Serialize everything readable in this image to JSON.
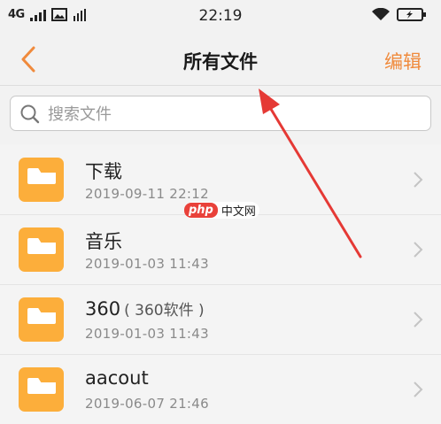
{
  "status_bar": {
    "network": "4G",
    "time": "22:19"
  },
  "nav": {
    "title": "所有文件",
    "edit_label": "编辑"
  },
  "search": {
    "placeholder": "搜索文件"
  },
  "files": [
    {
      "name": "下载",
      "sub": "",
      "date": "2019-09-11 22:12"
    },
    {
      "name": "音乐",
      "sub": "",
      "date": "2019-01-03 11:43"
    },
    {
      "name": "360",
      "sub": "( 360软件 )",
      "date": "2019-01-03 11:43"
    },
    {
      "name": "aacout",
      "sub": "",
      "date": "2019-06-07 21:46"
    }
  ],
  "watermark": {
    "logo": "php",
    "text": "中文网"
  },
  "colors": {
    "accent": "#f08a3c",
    "folder": "#fcae3b",
    "annotation_arrow": "#e53935"
  }
}
